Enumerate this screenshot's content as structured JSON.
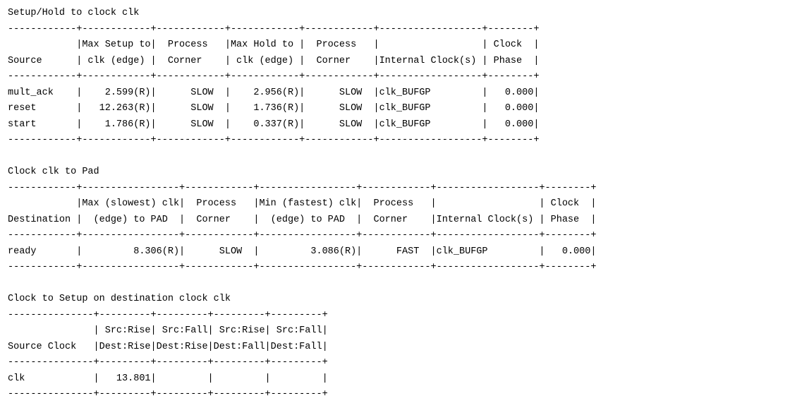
{
  "sections": [
    {
      "lines": [
        "Setup/Hold to clock clk",
        "------------+------------+------------+------------+------------+------------------+--------+",
        "            |Max Setup to|  Process   |Max Hold to |  Process   |                  | Clock  |",
        "Source      | clk (edge) |  Corner    | clk (edge) |  Corner    |Internal Clock(s) | Phase  |",
        "------------+------------+------------+------------+------------+------------------+--------+",
        "mult_ack    |    2.599(R)|      SLOW  |    2.956(R)|      SLOW  |clk_BUFGP         |   0.000|",
        "reset       |   12.263(R)|      SLOW  |    1.736(R)|      SLOW  |clk_BUFGP         |   0.000|",
        "start       |    1.786(R)|      SLOW  |    0.337(R)|      SLOW  |clk_BUFGP         |   0.000|",
        "------------+------------+------------+------------+------------+------------------+--------+"
      ]
    },
    {
      "lines": [
        "Clock clk to Pad",
        "------------+-----------------+------------+-----------------+------------+------------------+--------+",
        "            |Max (slowest) clk|  Process   |Min (fastest) clk|  Process   |                  | Clock  |",
        "Destination |  (edge) to PAD  |  Corner    |  (edge) to PAD  |  Corner    |Internal Clock(s) | Phase  |",
        "------------+-----------------+------------+-----------------+------------+------------------+--------+",
        "ready       |         8.306(R)|      SLOW  |         3.086(R)|      FAST  |clk_BUFGP         |   0.000|",
        "------------+-----------------+------------+-----------------+------------+------------------+--------+"
      ]
    },
    {
      "lines": [
        "Clock to Setup on destination clock clk",
        "---------------+---------+---------+---------+---------+",
        "               | Src:Rise| Src:Fall| Src:Rise| Src:Fall|",
        "Source Clock   |Dest:Rise|Dest:Rise|Dest:Fall|Dest:Fall|",
        "---------------+---------+---------+---------+---------+",
        "clk            |   13.801|         |         |         |",
        "---------------+---------+---------+---------+---------+"
      ]
    }
  ]
}
